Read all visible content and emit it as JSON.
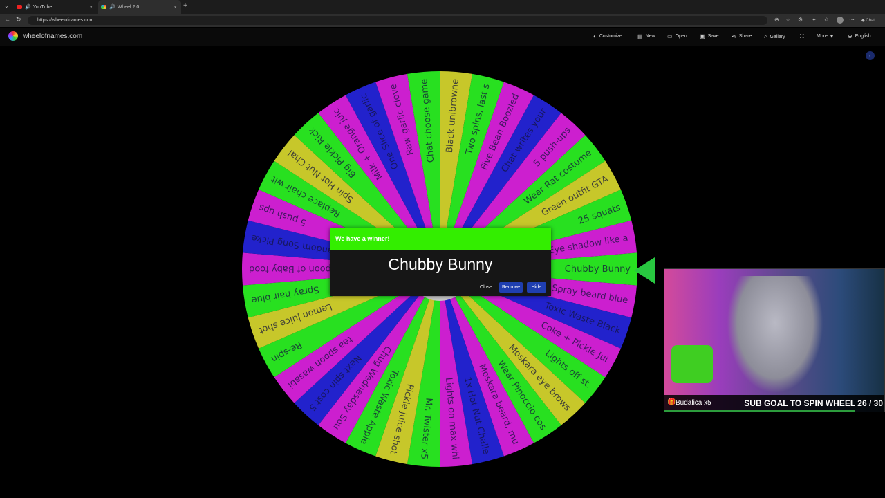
{
  "browser": {
    "tabs": [
      {
        "label": "YouTube",
        "close": "×"
      },
      {
        "label": "Wheel 2.0",
        "close": "×"
      }
    ],
    "new_tab": "+",
    "url": "https://wheelofnames.com",
    "chat_label": "Chat"
  },
  "site": {
    "title": "wheelofnames.com",
    "menu": [
      {
        "label": "Customize",
        "icon": "palette-icon"
      },
      {
        "label": "New",
        "icon": "file-icon"
      },
      {
        "label": "Open",
        "icon": "folder-icon"
      },
      {
        "label": "Save",
        "icon": "save-icon"
      },
      {
        "label": "Share",
        "icon": "share-icon"
      },
      {
        "label": "Gallery",
        "icon": "search-icon"
      },
      {
        "label": "",
        "icon": "fullscreen-icon"
      },
      {
        "label": "More",
        "icon": "chevron-down-icon"
      },
      {
        "label": "English",
        "icon": "globe-icon"
      }
    ]
  },
  "colors": {
    "green": "#28e020",
    "magenta": "#cc1fcf",
    "blue": "#2222cc",
    "yellow": "#c7c72a",
    "accent": "#33ee00",
    "button": "#1f3fb0"
  },
  "wheel": {
    "entries": [
      "Chubby Bunny",
      "Spray beard blue",
      "Toxic Waste Black",
      "Coke + Pickle Jui",
      "Lights off st.",
      "Moskara eye brows",
      "Wear Pinoccio cos",
      "Moskara beard, mu",
      "1x Hot Nut Challe",
      "Lights on max whi",
      "Mr. Twister x5",
      "Pickle juice shot",
      "Toxic Waste Apple",
      "Chug Wednesday Sou",
      "Next spin cost 5",
      "tea spoon wasabi",
      "Re-spin",
      "Lemon juice shot",
      "Spray hair blue",
      "Spoon of Baby food",
      "Random Song Picke",
      "5 push ups",
      "Replace chair wit",
      "Spin Hot Nut Chal",
      "Big Pickle Rick",
      "Milk + Orange juic",
      "One Slice of garlic",
      "Raw garlic clove",
      "Chat choose game",
      "Black unibrowne",
      "Two spins, last s",
      "Five Bean Boozled",
      "Chat writes your",
      "5 push-ups",
      "Wear Rat costume",
      "Green outfit GTA",
      "25 squats",
      "Eye shadow like a"
    ]
  },
  "dialog": {
    "header": "We have a winner!",
    "winner": "Chubby Bunny",
    "close": "Close",
    "remove": "Remove",
    "hide": "Hide"
  },
  "webcam": {
    "username": "Budalica x5",
    "goal": "SUB GOAL TO SPIN WHEEL 26 / 30",
    "goal_progress": 0.8667
  }
}
